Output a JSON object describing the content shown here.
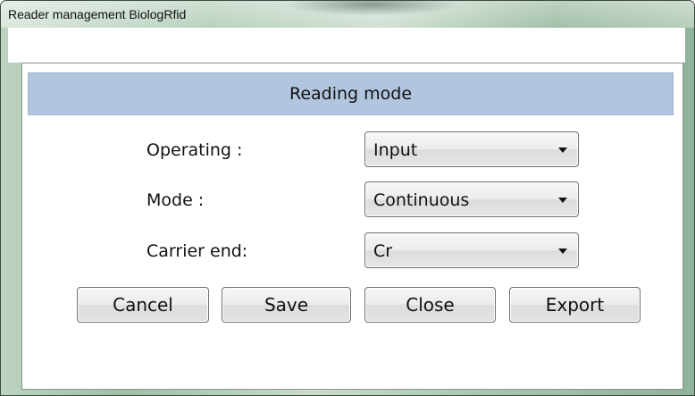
{
  "window": {
    "title": "Reader management BiologRfid"
  },
  "panel": {
    "header": "Reading mode"
  },
  "fields": {
    "operating": {
      "label": "Operating :",
      "value": "Input"
    },
    "mode": {
      "label": "Mode :",
      "value": "Continuous"
    },
    "carrier_end": {
      "label": "Carrier end:",
      "value": "Cr"
    }
  },
  "buttons": {
    "cancel": "Cancel",
    "save": "Save",
    "close": "Close",
    "export": "Export"
  },
  "icons": {
    "dropdown": "chevron-down-icon"
  },
  "colors": {
    "header_bg": "#b1c6de",
    "frame": "#a9c6b0"
  }
}
